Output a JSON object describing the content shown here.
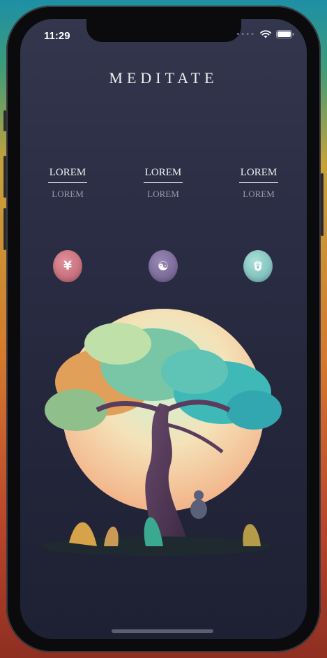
{
  "status_bar": {
    "time": "11:29"
  },
  "app": {
    "title": "MEDITATE"
  },
  "stats": [
    {
      "label": "LOREM",
      "value": "LOREM"
    },
    {
      "label": "LOREM",
      "value": "LOREM"
    },
    {
      "label": "LOREM",
      "value": "LOREM"
    }
  ],
  "actions": [
    {
      "icon": "yen-icon",
      "glyph": "¥",
      "color": "#c9707d"
    },
    {
      "icon": "yin-yang-icon",
      "glyph": "☯",
      "color": "#7d6a99"
    },
    {
      "icon": "hamsa-hand-icon",
      "glyph": "✋",
      "color": "#7fc2c0"
    }
  ],
  "illustration": {
    "icon": "meditation-tree-illustration"
  },
  "colors": {
    "background": "#2a2d44",
    "title": "#f2eef0",
    "muted": "#9b98aa"
  }
}
